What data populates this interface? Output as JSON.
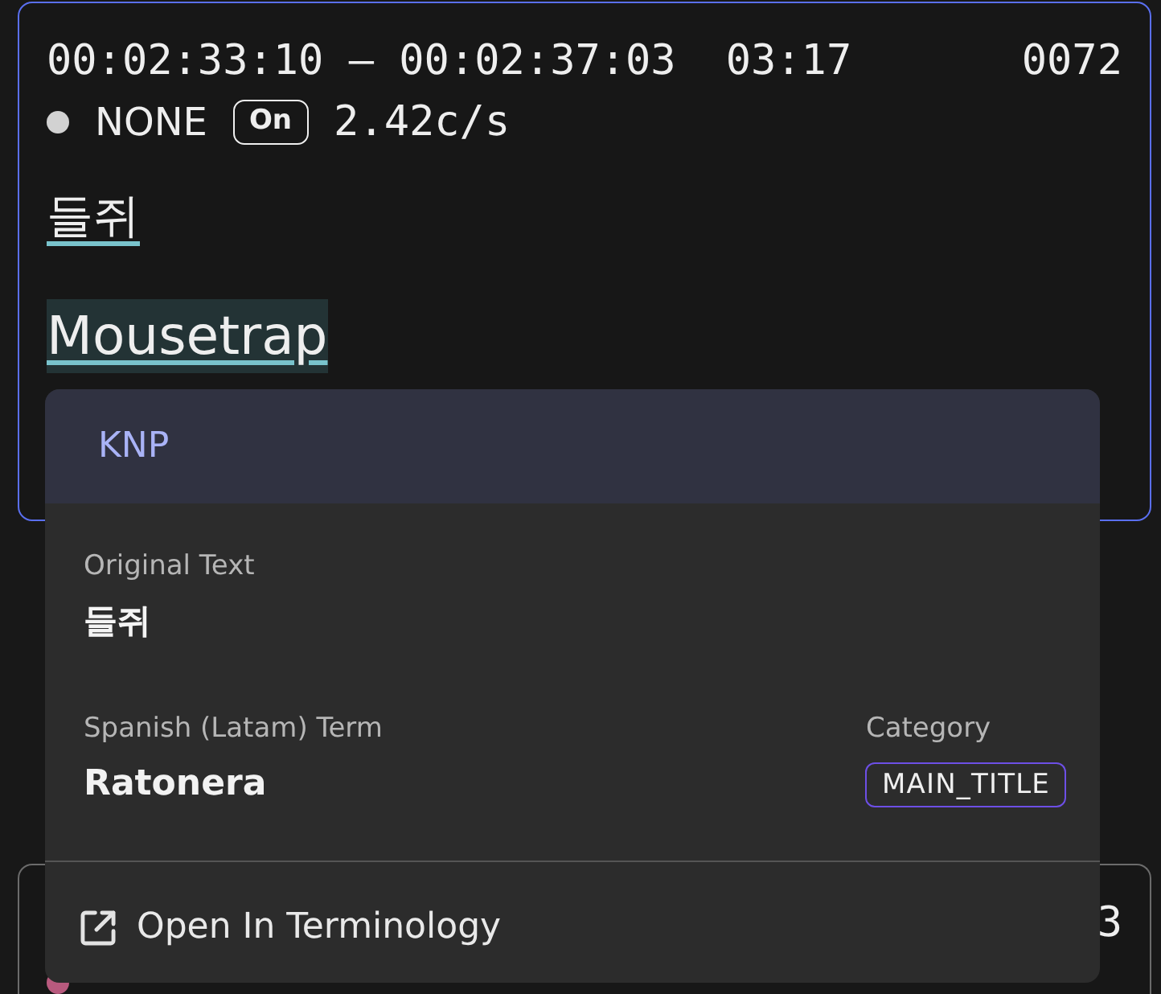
{
  "cards": [
    {
      "selected": true,
      "time_range": "00:02:33:10 – 00:02:37:03",
      "duration": "03:17",
      "number": "0072",
      "color": "#d2d2d2",
      "status": "NONE",
      "badge": "On",
      "rate": "2.42c/s",
      "source_text": "들쥐",
      "target_text": "Mousetrap",
      "target_highlighted": true
    },
    {
      "selected": false,
      "number": "3",
      "color": "#b85a7e"
    }
  ],
  "popover": {
    "header": "KNP",
    "original_label": "Original Text",
    "original_text": "들쥐",
    "term_label": "Spanish (Latam) Term",
    "term": "Ratonera",
    "category_label": "Category",
    "category": "MAIN_TITLE",
    "action": "Open In Terminology"
  }
}
